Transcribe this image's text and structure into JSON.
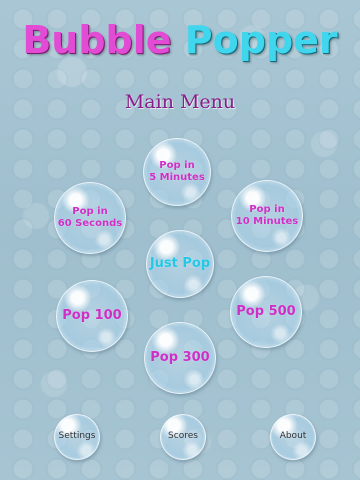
{
  "header": {
    "title_part1": "Bubble",
    "title_part2": "Popper",
    "subtitle": "Main Menu"
  },
  "menu": {
    "pop_5_min": {
      "line1": "Pop in",
      "line2": "5 Minutes"
    },
    "pop_60_sec": {
      "line1": "Pop in",
      "line2": "60 Seconds"
    },
    "pop_10_min": {
      "line1": "Pop in",
      "line2": "10 Minutes"
    },
    "just_pop": "Just Pop",
    "pop_100": "Pop 100",
    "pop_500": "Pop 500",
    "pop_300": "Pop 300"
  },
  "footer": {
    "settings": "Settings",
    "scores": "Scores",
    "about": "About"
  },
  "colors": {
    "magenta": "#cf2fc6",
    "cyan": "#23c8e6",
    "title_pink": "#e24bd3",
    "title_cyan": "#3fd6ee",
    "subtitle_purple": "#8b1c8a"
  }
}
